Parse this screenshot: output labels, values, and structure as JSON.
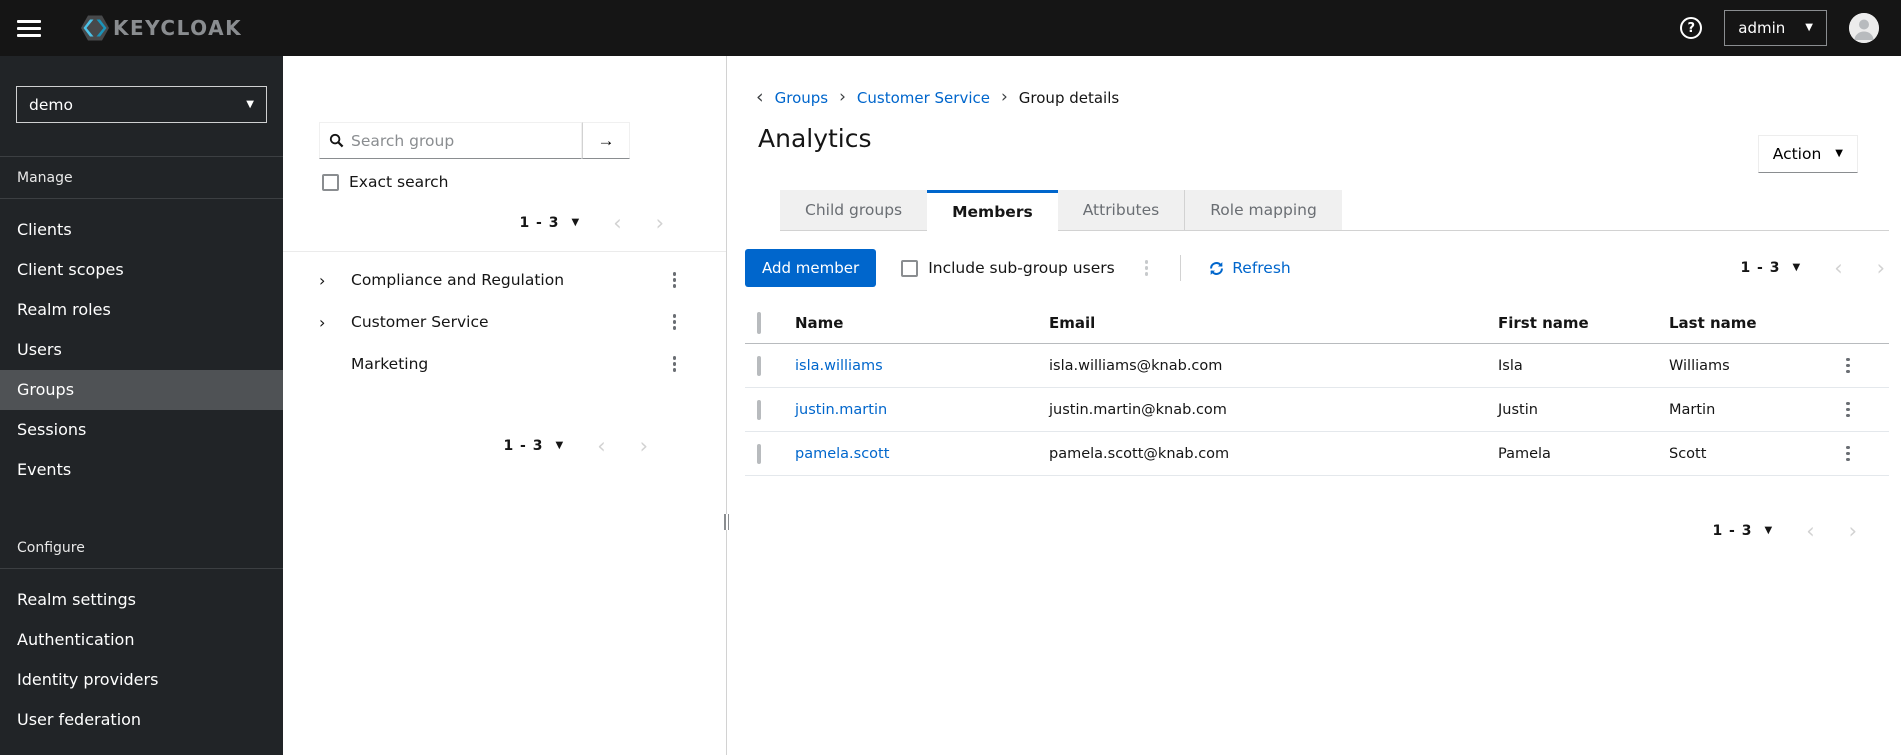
{
  "header": {
    "brand": "KEYCLOAK",
    "user": "admin"
  },
  "sidebar": {
    "realm": "demo",
    "sections": [
      {
        "label": "Manage",
        "items": [
          {
            "label": "Clients",
            "selected": false
          },
          {
            "label": "Client scopes",
            "selected": false
          },
          {
            "label": "Realm roles",
            "selected": false
          },
          {
            "label": "Users",
            "selected": false
          },
          {
            "label": "Groups",
            "selected": true
          },
          {
            "label": "Sessions",
            "selected": false
          },
          {
            "label": "Events",
            "selected": false
          }
        ]
      },
      {
        "label": "Configure",
        "items": [
          {
            "label": "Realm settings",
            "selected": false
          },
          {
            "label": "Authentication",
            "selected": false
          },
          {
            "label": "Identity providers",
            "selected": false
          },
          {
            "label": "User federation",
            "selected": false
          }
        ]
      }
    ]
  },
  "tree": {
    "search_placeholder": "Search group",
    "exact_search": "Exact search",
    "pagination_top": "1 - 3",
    "pagination_bottom": "1 - 3",
    "groups": [
      {
        "label": "Compliance and Regulation",
        "expandable": true
      },
      {
        "label": "Customer Service",
        "expandable": true
      },
      {
        "label": "Marketing",
        "expandable": false
      }
    ]
  },
  "main": {
    "breadcrumb": {
      "items": [
        "Groups",
        "Customer Service",
        "Group details"
      ]
    },
    "title": "Analytics",
    "action": "Action",
    "tabs": [
      "Child groups",
      "Members",
      "Attributes",
      "Role mapping"
    ],
    "active_tab": "Members",
    "toolbar": {
      "add_member": "Add member",
      "include_subgroups": "Include sub-group users",
      "refresh": "Refresh",
      "pagination": "1 - 3"
    },
    "table": {
      "columns": [
        "Name",
        "Email",
        "First name",
        "Last name"
      ],
      "rows": [
        {
          "name": "isla.williams",
          "email": "isla.williams@knab.com",
          "first_name": "Isla",
          "last_name": "Williams"
        },
        {
          "name": "justin.martin",
          "email": "justin.martin@knab.com",
          "first_name": "Justin",
          "last_name": "Martin"
        },
        {
          "name": "pamela.scott",
          "email": "pamela.scott@knab.com",
          "first_name": "Pamela",
          "last_name": "Scott"
        }
      ]
    },
    "pagination_bottom": "1 - 3"
  },
  "colors": {
    "accent": "#0066cc",
    "header_bg": "#151515",
    "sidebar_bg": "#212427",
    "sidebar_selected": "#4f5255",
    "link": "#0066cc"
  }
}
